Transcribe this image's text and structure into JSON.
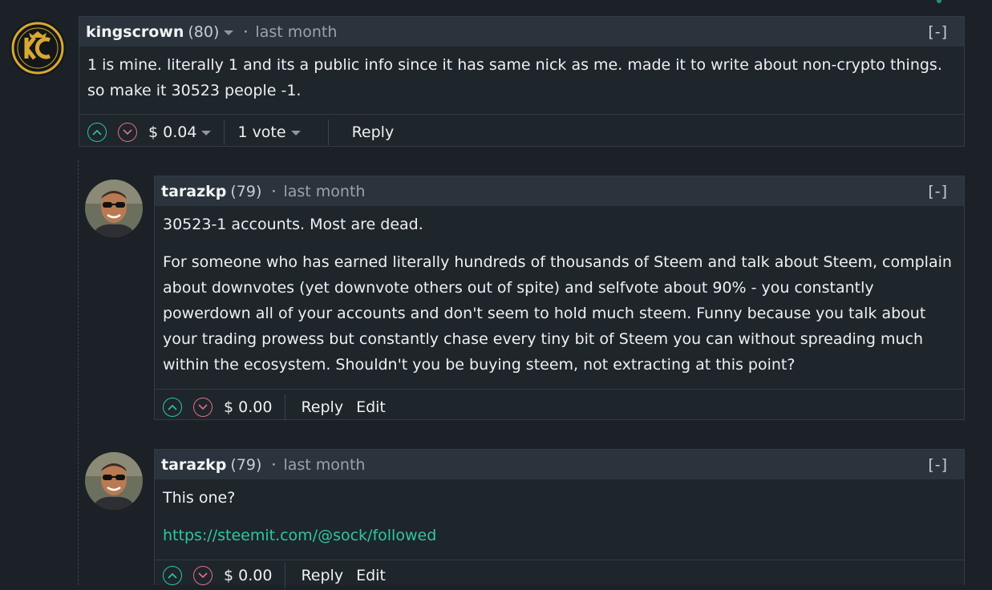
{
  "comments": [
    {
      "author": "kingscrown",
      "reputation": "(80)",
      "separator": "·",
      "time": "last month",
      "collapse": "[-]",
      "body": [
        "1 is mine. literally 1 and its a public info since it has same nick as me. made it to write about non-crypto things. so make it 30523 people -1."
      ],
      "payout": "$ 0.04",
      "votes": "1 vote",
      "reply": "Reply"
    },
    {
      "author": "tarazkp",
      "reputation": "(79)",
      "separator": "·",
      "time": "last month",
      "collapse": "[-]",
      "body": [
        "30523-1 accounts. Most are dead.",
        "For someone who has earned literally hundreds of thousands of Steem and talk about Steem, complain about downvotes (yet downvote others out of spite) and selfvote about 90% - you constantly powerdown all of your accounts and don't seem to hold much steem. Funny because you talk about your trading prowess but constantly chase every tiny bit of Steem you can without spreading much within the ecosystem. Shouldn't you be buying steem, not extracting at this point?"
      ],
      "payout": "$ 0.00",
      "reply": "Reply",
      "edit": "Edit"
    },
    {
      "author": "tarazkp",
      "reputation": "(79)",
      "separator": "·",
      "time": "last month",
      "collapse": "[-]",
      "body": [
        "This one?"
      ],
      "link": "https://steemit.com/@sock/followed",
      "payout": "$ 0.00",
      "reply": "Reply",
      "edit": "Edit"
    }
  ],
  "colors": {
    "background": "#1b2126",
    "header": "#2b343c",
    "upvote": "#2fc7a0",
    "downvote": "#e0718a",
    "link": "#2fc7a0"
  },
  "icons": [
    "upvote-icon",
    "downvote-icon",
    "caret-down-icon",
    "avatar-kingscrown-logo",
    "avatar-tarazkp-photo"
  ]
}
